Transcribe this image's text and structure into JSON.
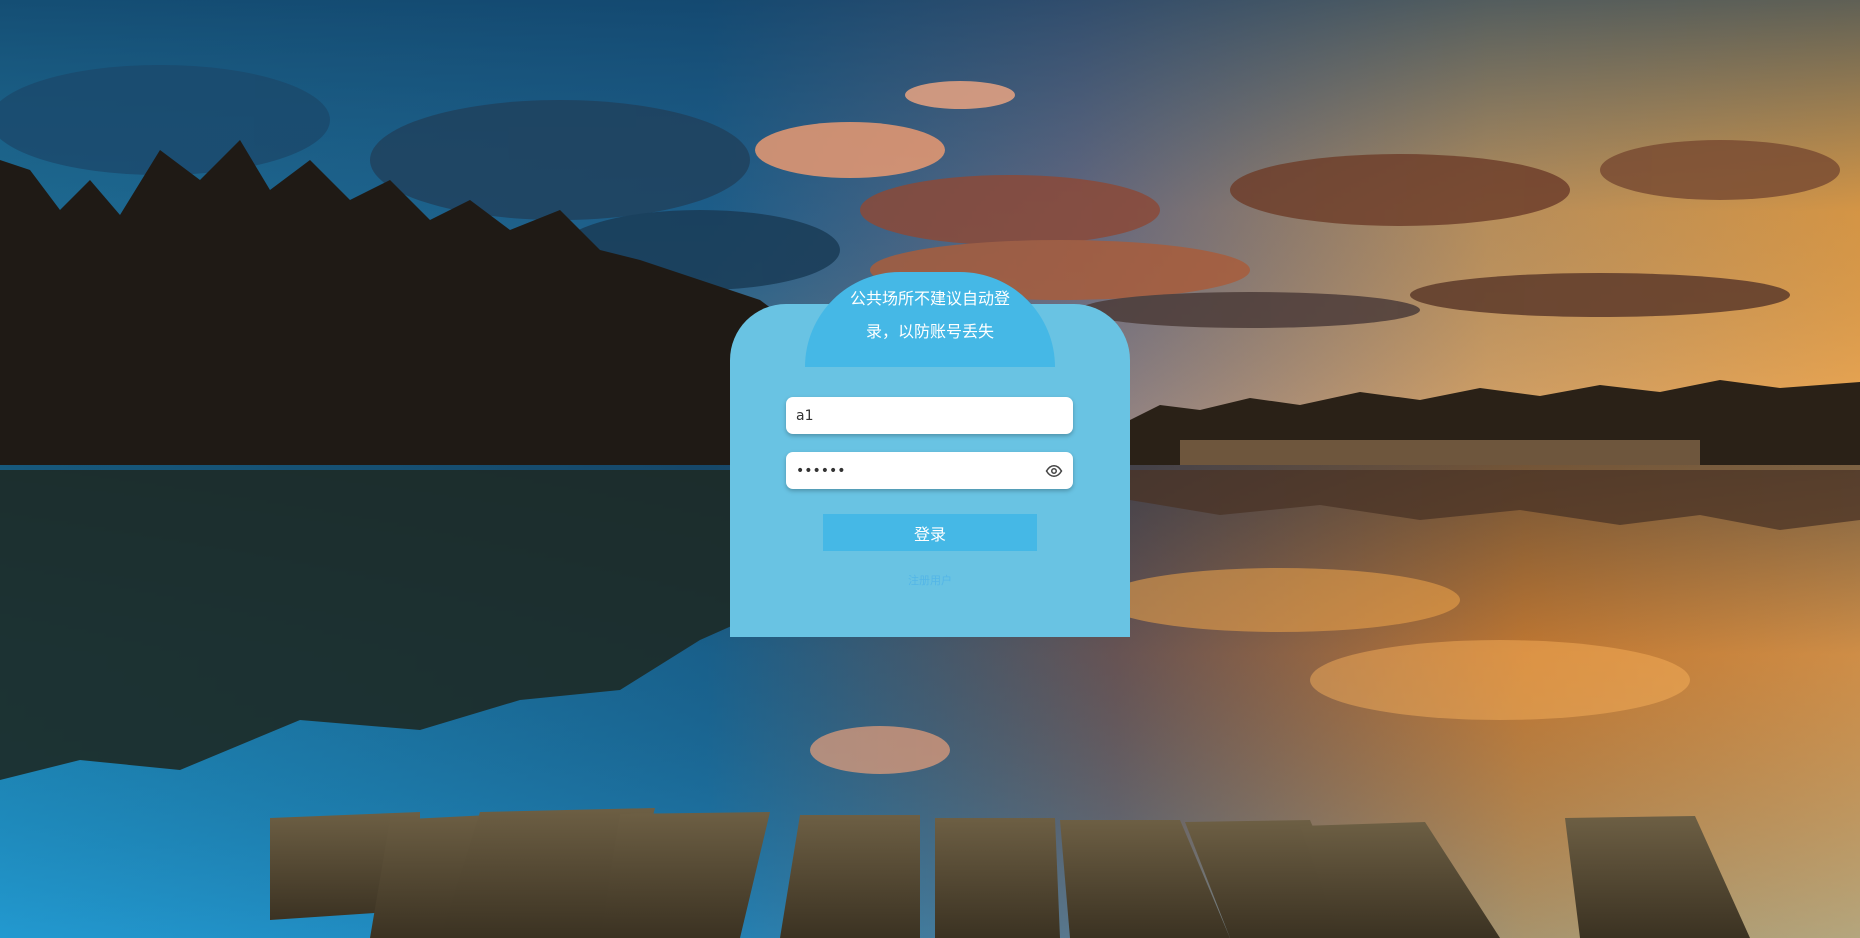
{
  "login": {
    "notice_line1": "公共场所不建议自动登",
    "notice_line2": "录，以防账号丢失",
    "username_value": "a1",
    "password_value": "123456",
    "login_button": "登录",
    "register_link": "注册用户"
  },
  "colors": {
    "card_bg": "#69c3e3",
    "header_bg": "#45b8e6",
    "button_bg": "#45b8e6"
  },
  "icons": {
    "password_toggle": "eye-icon"
  }
}
